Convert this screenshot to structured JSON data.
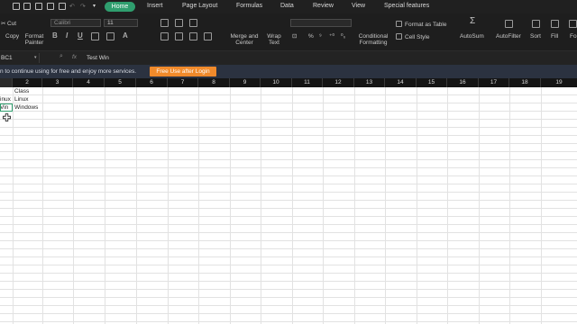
{
  "menu": {
    "items": [
      "Home",
      "Insert",
      "Page Layout",
      "Formulas",
      "Data",
      "Review",
      "View",
      "Special features"
    ],
    "active": "Home"
  },
  "ribbon": {
    "cut": "Cut",
    "copy": "Copy",
    "format_painter": "Format Painter",
    "font_name": "Calibri",
    "font_size": "11",
    "merge_center": "Merge and Center",
    "wrap_text": "Wrap Text",
    "conditional_formatting": "Conditional Formatting",
    "format_as_table": "Format as Table",
    "cell_style": "Cell Style",
    "autosum": "AutoSum",
    "autofilter": "AutoFilter",
    "sort": "Sort",
    "fill": "Fill",
    "format_partial": "Fo"
  },
  "formula_bar": {
    "name_box": "BC1",
    "fx": "fx",
    "content": "Test Win"
  },
  "notice": {
    "text": "n to continue using for free and enjoy more services.",
    "button": "Free Use after Login"
  },
  "columns": [
    "",
    "2",
    "3",
    "4",
    "5",
    "6",
    "7",
    "8",
    "9",
    "10",
    "11",
    "12",
    "13",
    "14",
    "15",
    "16",
    "17",
    "18",
    "19"
  ],
  "cells": {
    "r1c2": "Class",
    "r2c1": "inux",
    "r2c2": "Linux",
    "r3c1": "Vin",
    "r3c2": "Windows"
  },
  "colors": {
    "accent": "#2f9e6e",
    "login_button": "#f08a2b",
    "notice_bg": "#2b3240"
  }
}
